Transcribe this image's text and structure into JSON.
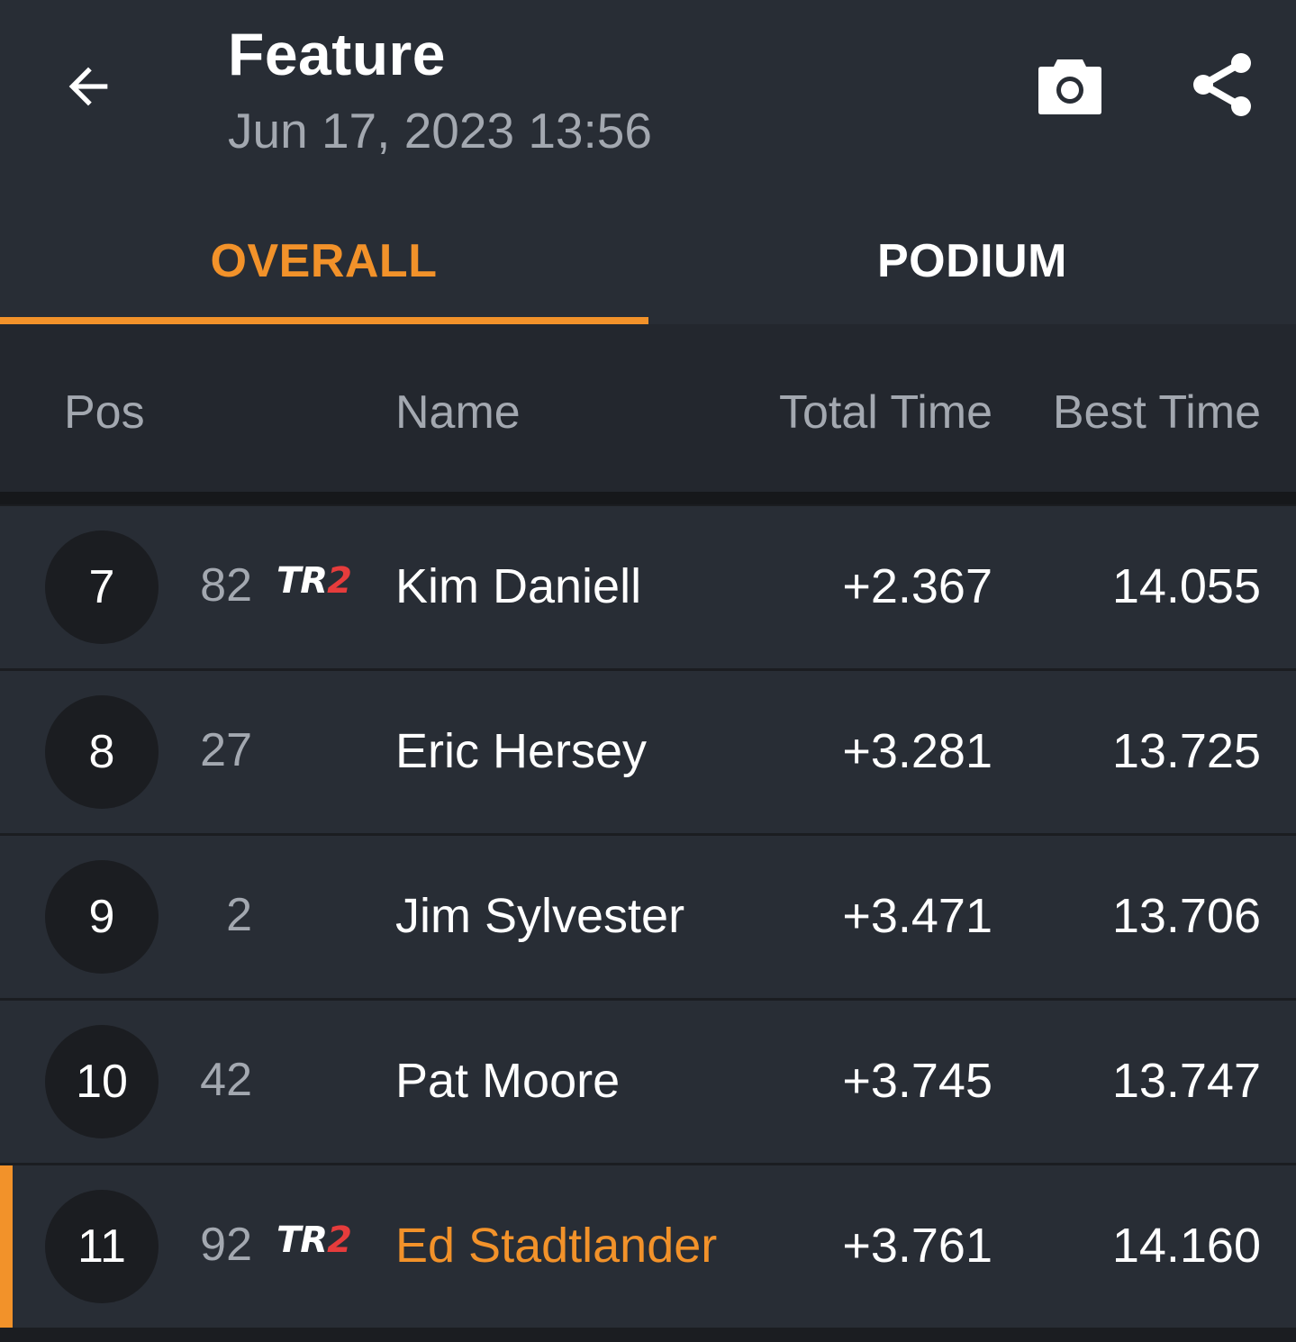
{
  "header": {
    "title": "Feature",
    "subtitle": "Jun 17, 2023 13:56",
    "back_icon": "arrow-left-icon",
    "camera_icon": "camera-icon",
    "share_icon": "share-icon"
  },
  "tabs": [
    {
      "label": "OVERALL",
      "active": true
    },
    {
      "label": "PODIUM",
      "active": false
    }
  ],
  "columns": {
    "pos": "Pos",
    "name": "Name",
    "total": "Total Time",
    "best": "Best Time"
  },
  "rows": [
    {
      "pos": "7",
      "car": "82",
      "badge": true,
      "name": "Kim Daniell",
      "total": "+2.367",
      "best": "14.055"
    },
    {
      "pos": "8",
      "car": "27",
      "badge": false,
      "name": "Eric Hersey",
      "total": "+3.281",
      "best": "13.725"
    },
    {
      "pos": "9",
      "car": "2",
      "badge": false,
      "name": "Jim Sylvester",
      "total": "+3.471",
      "best": "13.706"
    },
    {
      "pos": "10",
      "car": "42",
      "badge": false,
      "name": "Pat Moore",
      "total": "+3.745",
      "best": "13.747"
    },
    {
      "pos": "11",
      "car": "92",
      "badge": true,
      "name": "Ed Stadtlander",
      "total": "+3.761",
      "best": "14.160",
      "highlighted": true
    }
  ],
  "badge": {
    "prefix": "TR",
    "suffix": "2"
  },
  "colors": {
    "accent": "#f2922a",
    "background": "#1b1d21",
    "surface": "#282d35",
    "text_secondary": "#a3a8b0",
    "badge_red": "#e63c3c"
  }
}
